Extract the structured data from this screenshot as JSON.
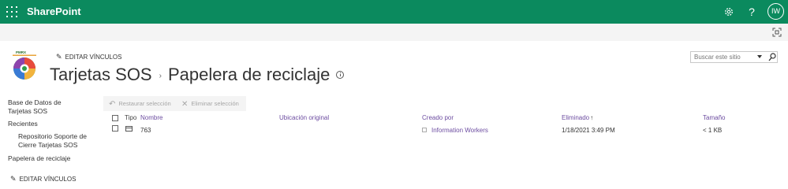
{
  "suitebar": {
    "app_name": "SharePoint",
    "help_glyph": "?",
    "avatar_initials": "IW",
    "color": "#0b8a5e"
  },
  "header": {
    "edit_links_label": "EDITAR VÍNCULOS",
    "site_title": "Tarjetas SOS",
    "separator": "›",
    "page_title": "Papelera de reciclaje",
    "search_placeholder": "Buscar este sitio"
  },
  "nav": {
    "items": [
      {
        "label": "Base de Datos de Tarjetas SOS"
      },
      {
        "label": "Recientes"
      },
      {
        "label": "Repositorio Soporte de Cierre Tarjetas SOS"
      },
      {
        "label": "Papelera de reciclaje"
      }
    ],
    "edit_links_label": "EDITAR VÍNCULOS"
  },
  "toolbar": {
    "restore_label": "Restaurar selección",
    "delete_label": "Eliminar selección"
  },
  "table": {
    "columns": {
      "type": "Tipo",
      "name": "Nombre",
      "original_location": "Ubicación original",
      "created_by": "Creado por",
      "deleted": "Eliminado",
      "size": "Tamaño"
    },
    "sort_arrow": "↑",
    "rows": [
      {
        "name": "763",
        "original_location": "",
        "created_by": "Information Workers",
        "deleted": "1/18/2021 3:49 PM",
        "size": "< 1 KB"
      }
    ]
  },
  "colors": {
    "link": "#6c4ca0",
    "disabled": "#a6a6a6"
  }
}
